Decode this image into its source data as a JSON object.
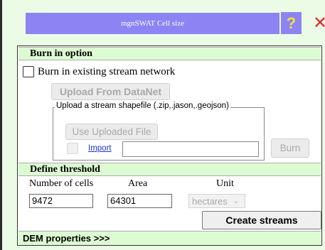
{
  "window": {
    "title": "mgnSWAT Cell size",
    "help_glyph": "?",
    "close_glyph": "✕",
    "title_bar_color": "#8c84f3"
  },
  "burn": {
    "header": "Burn in option",
    "checkbox_label": "Burn in existing stream network",
    "checkbox_checked": false,
    "upload_button": "Upload From DataNet",
    "shapefile_legend": "Upload a stream shapefile (.zip,.jason,.geojson)",
    "use_uploaded_button": "Use Uploaded File",
    "import_link": "Import",
    "import_value": "",
    "burn_button": "Burn"
  },
  "threshold": {
    "header": "Define threshold",
    "cells_label": "Number of cells",
    "area_label": "Area",
    "unit_label": "Unit",
    "cells_value": "9472",
    "area_value": "64301",
    "unit_value": "hectares",
    "create_button": "Create streams"
  },
  "dem": {
    "header": "DEM properties >>>"
  },
  "colors": {
    "panel_background": "#ecfbe6",
    "section_header": "#ddfbd2",
    "link": "#1a36c9"
  }
}
